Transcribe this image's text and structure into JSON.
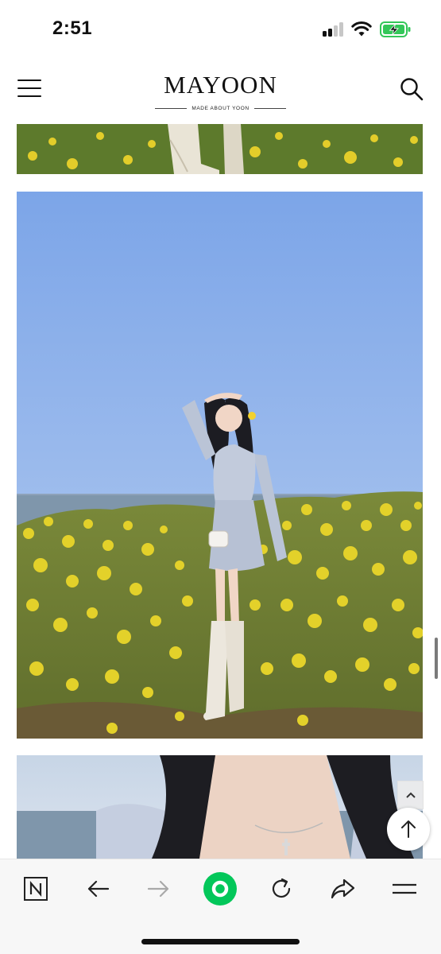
{
  "status_bar": {
    "time": "2:51",
    "signal_icon": "cellular-signal-icon",
    "wifi_icon": "wifi-icon",
    "battery_icon": "battery-charging-icon",
    "battery_color": "#34c759"
  },
  "header": {
    "brand_name": "MAYOON",
    "brand_tagline": "MADE ABOUT YOON",
    "menu_icon": "hamburger-menu-icon",
    "search_icon": "search-icon"
  },
  "gallery": {
    "images": [
      {
        "name": "product-photo-top-cropped",
        "visible_fraction": 0.1
      },
      {
        "name": "product-photo-model-rapeseed-field",
        "visible_fraction": 1.0
      },
      {
        "name": "product-photo-closeup-necklace",
        "visible_fraction": 0.2
      }
    ]
  },
  "floating_buttons": {
    "scroll_up_small_icon": "chevron-up-icon",
    "scroll_to_top_icon": "arrow-up-icon"
  },
  "browser_toolbar": {
    "buttons": [
      "naver-home-icon",
      "back-arrow-icon",
      "forward-arrow-icon",
      "green-dot-icon",
      "reload-icon",
      "share-icon",
      "menu-icon"
    ],
    "accent_color": "#03c75a"
  }
}
